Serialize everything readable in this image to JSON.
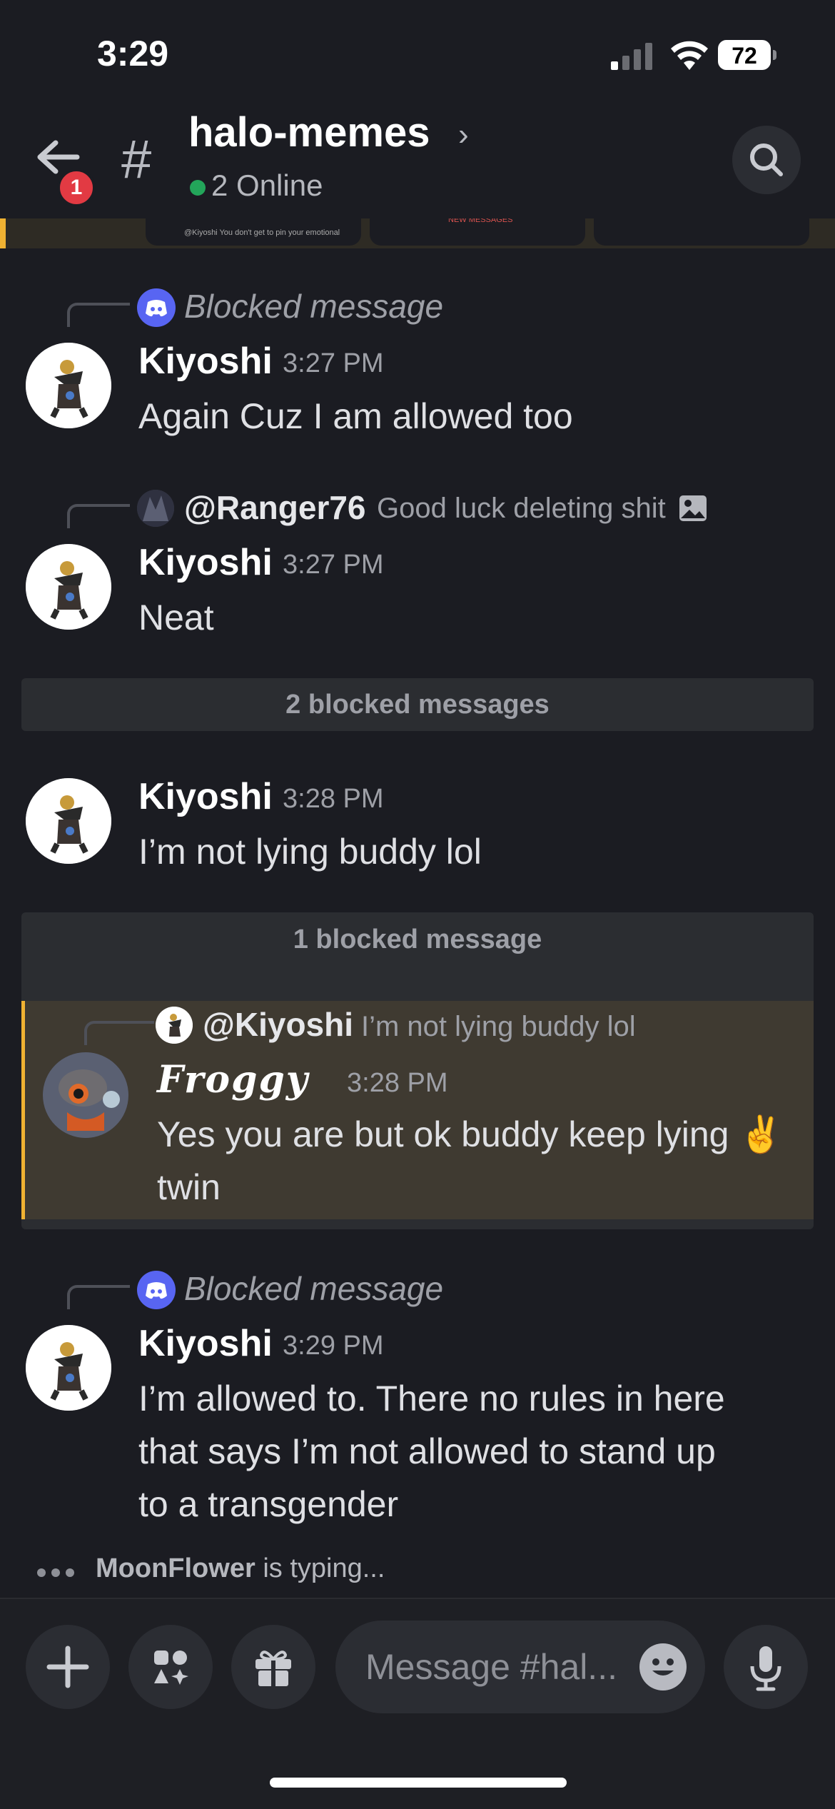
{
  "status_bar": {
    "time": "3:29",
    "battery": "72"
  },
  "header": {
    "back_badge": "1",
    "hash": "#",
    "channel": "halo-memes",
    "chevron": "›",
    "online": "2 Online"
  },
  "pinned_strip": {
    "new_label": "NEW MESSAGES",
    "snippet": "@Kiyoshi You don't get to pin your emotional"
  },
  "messages": [
    {
      "reply": {
        "label": "Blocked message"
      },
      "author": "Kiyoshi",
      "time": "3:27 PM",
      "text": "Again Cuz I am allowed too"
    },
    {
      "reply": {
        "user": "@Ranger76",
        "snippet": "Good luck deleting shit"
      },
      "author": "Kiyoshi",
      "time": "3:27 PM",
      "text": "Neat"
    },
    {
      "blocked_bar": "2 blocked messages"
    },
    {
      "author": "Kiyoshi",
      "time": "3:28 PM",
      "text": "I’m not lying buddy lol"
    },
    {
      "blocked_bar": "1 blocked message"
    },
    {
      "reply": {
        "user": "@Kiyoshi",
        "snippet": "I’m not lying buddy lol"
      },
      "author": "Froggy",
      "time": "3:28 PM",
      "text_line1": "Yes you are but ok buddy keep lying ✌️",
      "text_line2": "twin"
    },
    {
      "reply": {
        "label": "Blocked message"
      },
      "author": "Kiyoshi",
      "time": "3:29 PM",
      "text_line1": "I’m allowed to. There no rules in here",
      "text_line2": "that says I’m not allowed to stand up",
      "text_line3": "to a transgender"
    }
  ],
  "typing": {
    "user": "MoonFlower",
    "suffix": " is typing..."
  },
  "composer": {
    "placeholder": "Message #hal..."
  },
  "colors": {
    "background": "#1b1c22",
    "accent_yellow": "#f0b232",
    "discord_blurple": "#5865f2",
    "online_green": "#23a55a",
    "badge_red": "#e23a43"
  },
  "icons": [
    "back-arrow-icon",
    "hash-icon",
    "chevron-right-icon",
    "search-icon",
    "discord-icon",
    "image-icon",
    "plus-icon",
    "apps-icon",
    "gift-icon",
    "emoji-icon",
    "microphone-icon"
  ]
}
